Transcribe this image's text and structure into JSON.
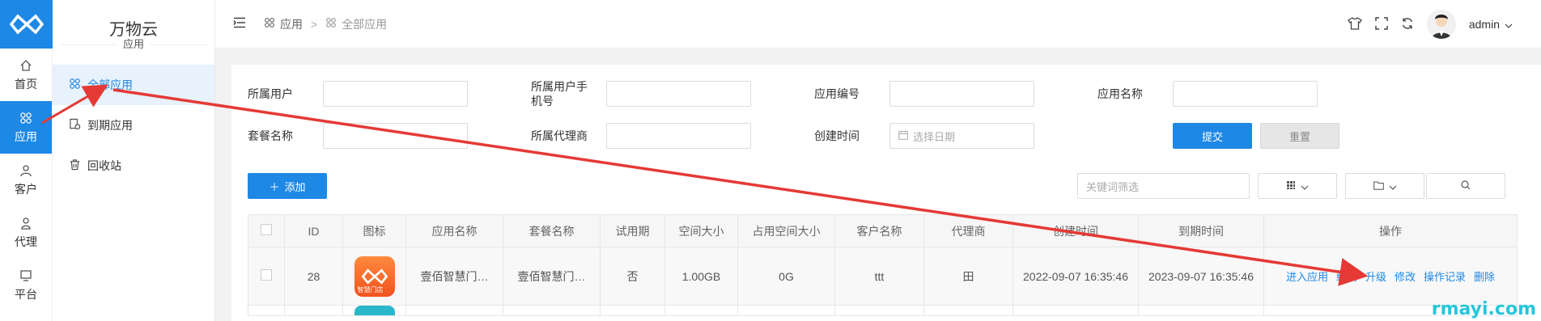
{
  "rail": {
    "items": [
      {
        "label": "首页",
        "icon": "home-icon"
      },
      {
        "label": "应用",
        "icon": "apps-icon"
      },
      {
        "label": "客户",
        "icon": "user-icon"
      },
      {
        "label": "代理",
        "icon": "agent-icon"
      },
      {
        "label": "平台",
        "icon": "platform-icon"
      }
    ],
    "active_index": 1
  },
  "subnav": {
    "title": "万物云",
    "subtitle": "应用",
    "items": [
      {
        "label": "全部应用",
        "icon": "apps-icon"
      },
      {
        "label": "到期应用",
        "icon": "expired-doc-icon"
      },
      {
        "label": "回收站",
        "icon": "trash-icon"
      }
    ]
  },
  "header": {
    "breadcrumb": [
      "应用",
      "全部应用"
    ],
    "user": "admin"
  },
  "filters": {
    "owner_user": "所属用户",
    "owner_phone": "所属用户手机号",
    "app_no": "应用编号",
    "app_name": "应用名称",
    "package_name": "套餐名称",
    "agent": "所属代理商",
    "created_time": "创建时间",
    "date_placeholder": "选择日期",
    "submit": "提交",
    "reset": "重置"
  },
  "toolbar": {
    "add": "添加",
    "keyword_placeholder": "关键词筛选"
  },
  "table": {
    "columns": [
      "ID",
      "图标",
      "应用名称",
      "套餐名称",
      "试用期",
      "空间大小",
      "占用空间大小",
      "客户名称",
      "代理商",
      "创建时间",
      "到期时间",
      "操作"
    ],
    "rows": [
      {
        "id": "28",
        "app_name": "壹佰智慧门…",
        "package_name": "壹佰智慧门…",
        "trial": "否",
        "space": "1.00GB",
        "used": "0G",
        "customer": "ttt",
        "agent": "田",
        "created": "2022-09-07 16:35:46",
        "expires": "2023-09-07 16:35:46",
        "icon_caption": "智慧门店"
      }
    ],
    "ops": [
      "进入应用",
      "续费",
      "升级",
      "修改",
      "操作记录",
      "删除"
    ]
  },
  "watermark": "rmayi.com",
  "colors": {
    "accent": "#1e88e5",
    "annotation": "#e53935"
  }
}
